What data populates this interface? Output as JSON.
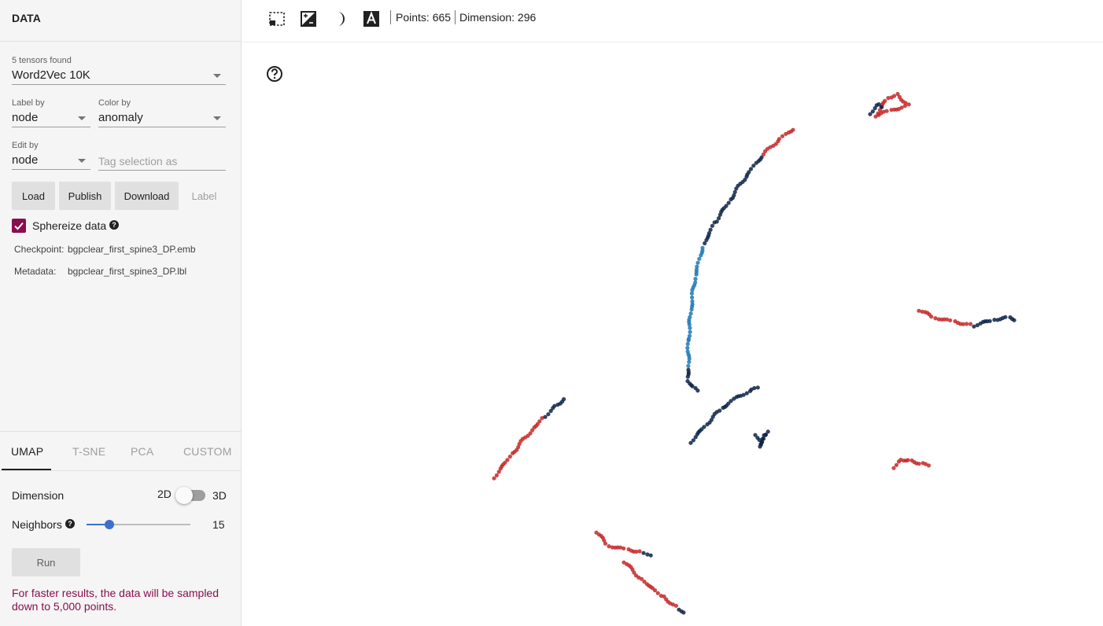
{
  "data_panel": {
    "title": "DATA",
    "tensors_label": "5 tensors found",
    "tensor_selected": "Word2Vec 10K",
    "label_by_label": "Label by",
    "label_by_value": "node",
    "color_by_label": "Color by",
    "color_by_value": "anomaly",
    "edit_by_label": "Edit by",
    "edit_by_value": "node",
    "tag_placeholder": "Tag selection as",
    "buttons": {
      "load": "Load",
      "publish": "Publish",
      "download": "Download",
      "label": "Label"
    },
    "sphereize_label": "Sphereize data",
    "sphereize_checked": true,
    "checkpoint_key": "Checkpoint:",
    "checkpoint_value": "bgpclear_first_spine3_DP.emb",
    "metadata_key": "Metadata:",
    "metadata_value": "bgpclear_first_spine3_DP.lbl"
  },
  "projection_panel": {
    "tabs": [
      "UMAP",
      "T-SNE",
      "PCA",
      "CUSTOM"
    ],
    "active_tab": "UMAP",
    "dimension_label": "Dimension",
    "dim_2d": "2D",
    "dim_3d": "3D",
    "dimension_3d_enabled": false,
    "neighbors_label": "Neighbors",
    "neighbors_value": "15",
    "neighbors_fraction": 0.22,
    "run_label": "Run",
    "note": "For faster results, the data will be sampled down to 5,000 points."
  },
  "toolbar": {
    "icons": [
      "select-rectangle-icon",
      "night-mode-icon",
      "moon-icon",
      "label-text-icon"
    ],
    "points_text": "Points: 665",
    "dimension_text": "Dimension: 296"
  },
  "colors": {
    "accent": "#880e4f",
    "slider": "#3f6fcf",
    "anomaly_high": "#c62828",
    "anomaly_mid": "#0d2347",
    "anomaly_low": "#1f78b4"
  }
}
